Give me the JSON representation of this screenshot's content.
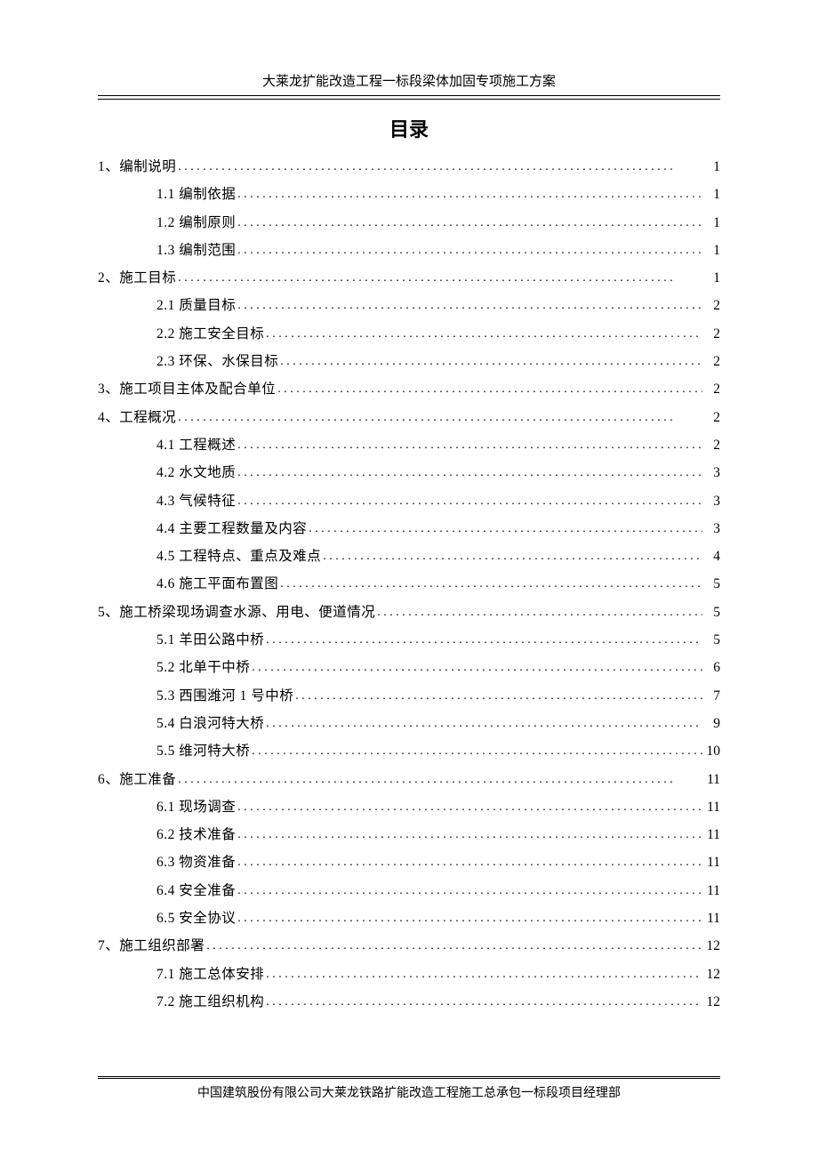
{
  "header": "大莱龙扩能改造工程一标段梁体加固专项施工方案",
  "title": "目录",
  "toc": [
    {
      "level": 1,
      "label": "1、编制说明",
      "page": "1"
    },
    {
      "level": 2,
      "label": "1.1 编制依据",
      "page": "1"
    },
    {
      "level": 2,
      "label": "1.2 编制原则",
      "page": "1"
    },
    {
      "level": 2,
      "label": "1.3 编制范围",
      "page": "1"
    },
    {
      "level": 1,
      "label": "2、施工目标",
      "page": "1"
    },
    {
      "level": 2,
      "label": "2.1 质量目标 ",
      "page": "2"
    },
    {
      "level": 2,
      "label": "2.2 施工安全目标",
      "page": "2"
    },
    {
      "level": 2,
      "label": "2.3 环保、水保目标",
      "page": "2"
    },
    {
      "level": 1,
      "label": "3、施工项目主体及配合单位",
      "page": "2"
    },
    {
      "level": 1,
      "label": "4、工程概况",
      "page": "2"
    },
    {
      "level": 2,
      "label": "4.1 工程概述",
      "page": "2"
    },
    {
      "level": 2,
      "label": "4.2 水文地质",
      "page": "3"
    },
    {
      "level": 2,
      "label": "4.3 气候特征",
      "page": "3"
    },
    {
      "level": 2,
      "label": "4.4 主要工程数量及内容",
      "page": "3"
    },
    {
      "level": 2,
      "label": "4.5 工程特点、重点及难点",
      "page": "4"
    },
    {
      "level": 2,
      "label": "4.6 施工平面布置图",
      "page": "5"
    },
    {
      "level": 1,
      "label": "5、施工桥梁现场调查水源、用电、便道情况",
      "page": "5"
    },
    {
      "level": 2,
      "label": "5.1 羊田公路中桥",
      "page": "5"
    },
    {
      "level": 2,
      "label": "5.2 北单干中桥",
      "page": "6"
    },
    {
      "level": 2,
      "label": "5.3 西围潍河 1 号中桥",
      "page": "7"
    },
    {
      "level": 2,
      "label": "5.4 白浪河特大桥",
      "page": "9"
    },
    {
      "level": 2,
      "label": "5.5 维河特大桥",
      "page": "10"
    },
    {
      "level": 1,
      "label": "6、施工准备",
      "page": "11"
    },
    {
      "level": 2,
      "label": "6.1 现场调查",
      "page": "11"
    },
    {
      "level": 2,
      "label": "6.2 技术准备",
      "page": "11"
    },
    {
      "level": 2,
      "label": "6.3 物资准备",
      "page": "11"
    },
    {
      "level": 2,
      "label": "6.4 安全准备",
      "page": "11"
    },
    {
      "level": 2,
      "label": "6.5 安全协议",
      "page": "11"
    },
    {
      "level": 1,
      "label": "7、施工组织部署",
      "page": "12"
    },
    {
      "level": 2,
      "label": "7.1 施工总体安排",
      "page": "12"
    },
    {
      "level": 2,
      "label": "7.2 施工组织机构",
      "page": "12"
    }
  ],
  "footer": "中国建筑股份有限公司大莱龙铁路扩能改造工程施工总承包一标段项目经理部"
}
